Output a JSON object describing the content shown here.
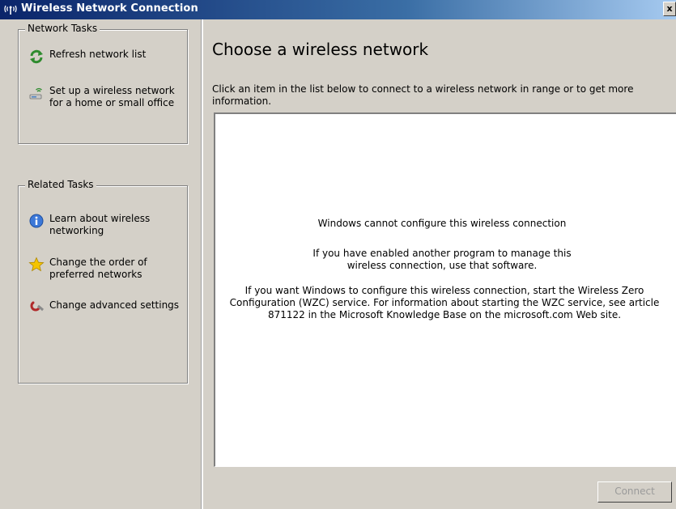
{
  "window": {
    "title": "Wireless Network Connection",
    "close_label": "x"
  },
  "network_tasks": {
    "title": "Network Tasks",
    "items": [
      {
        "label": "Refresh network list",
        "icon": "refresh-icon"
      },
      {
        "label": "Set up a wireless network for a home or small office",
        "icon": "wireless-setup-icon"
      }
    ]
  },
  "related_tasks": {
    "title": "Related Tasks",
    "items": [
      {
        "label": "Learn about wireless networking",
        "icon": "info-icon"
      },
      {
        "label": "Change the order of preferred networks",
        "icon": "star-icon"
      },
      {
        "label": "Change advanced settings",
        "icon": "settings-icon"
      }
    ]
  },
  "main": {
    "heading": "Choose a wireless network",
    "instructions": "Click an item in the list below to connect to a wireless network in range or to get more information.",
    "messages": [
      "Windows cannot configure this wireless connection",
      "If you have enabled another program to manage this wireless connection, use that software.",
      "If you want Windows to configure this wireless connection, start the Wireless Zero Configuration (WZC) service. For information about starting the WZC service, see article 871122 in the Microsoft Knowledge Base on the microsoft.com Web site."
    ],
    "connect_label": "Connect"
  }
}
